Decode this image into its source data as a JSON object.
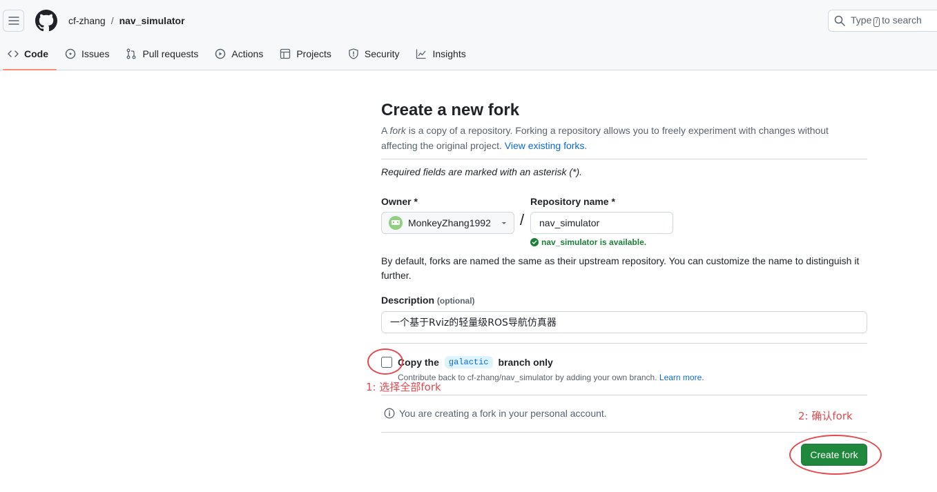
{
  "header": {
    "owner": "cf-zhang",
    "separator": "/",
    "repo": "nav_simulator",
    "search_pre": "Type",
    "search_key": "/",
    "search_post": "to search"
  },
  "tabs": [
    {
      "label": "Code",
      "icon": "code-icon"
    },
    {
      "label": "Issues",
      "icon": "issue-icon"
    },
    {
      "label": "Pull requests",
      "icon": "pull-request-icon"
    },
    {
      "label": "Actions",
      "icon": "play-icon"
    },
    {
      "label": "Projects",
      "icon": "table-icon"
    },
    {
      "label": "Security",
      "icon": "shield-icon"
    },
    {
      "label": "Insights",
      "icon": "graph-icon"
    }
  ],
  "form": {
    "title": "Create a new fork",
    "subtitle_1": "A",
    "subtitle_fork": "fork",
    "subtitle_2": "is a copy of a repository. Forking a repository allows you to freely experiment with changes without affecting the original project.",
    "view_forks": "View existing forks.",
    "required_note": "Required fields are marked with an asterisk (*).",
    "owner_label": "Owner *",
    "repo_label": "Repository name *",
    "owner_value": "MonkeyZhang1992",
    "slash": "/",
    "repo_value": "nav_simulator",
    "available": "nav_simulator is available.",
    "default_note": "By default, forks are named the same as their upstream repository. You can customize the name to distinguish it further.",
    "desc_label": "Description",
    "desc_optional": "(optional)",
    "desc_value": "一个基于Rviz的轻量级ROS导航仿真器",
    "copy_pre": "Copy the",
    "copy_branch": "galactic",
    "copy_post": "branch only",
    "copy_hint": "Contribute back to cf-zhang/nav_simulator by adding your own branch.",
    "learn_more": "Learn more.",
    "info": "You are creating a fork in your personal account.",
    "create_button": "Create fork"
  },
  "annotations": {
    "step1": "1: 选择全部fork",
    "step2": "2: 确认fork"
  },
  "colors": {
    "accent_green": "#1f883d",
    "link_blue": "#0969da",
    "annotation_red": "#e5484d",
    "tab_underline": "#fd8c73"
  }
}
